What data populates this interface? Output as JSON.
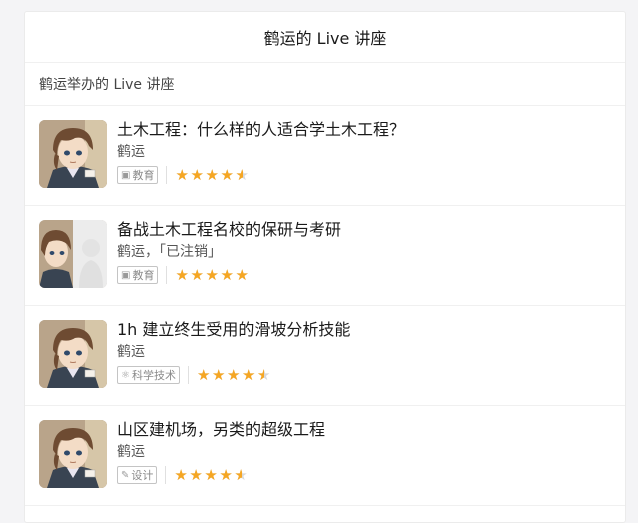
{
  "header": {
    "title": "鹤运的 Live 讲座"
  },
  "subheader": {
    "label": "鹤运举办的 Live 讲座"
  },
  "colors": {
    "star": "#f5a623",
    "star_empty": "#d9d9d9"
  },
  "lives": [
    {
      "title": "土木工程：什么样的人适合学土木工程？",
      "speaker": "鹤运",
      "tag": "教育",
      "tag_icon": "education-icon",
      "rating": 4.5,
      "cover": "anime-avatar"
    },
    {
      "title": "备战土木工程名校的保研与考研",
      "speaker": "鹤运，「已注销」",
      "tag": "教育",
      "tag_icon": "education-icon",
      "rating": 5,
      "cover": "split-avatar"
    },
    {
      "title": "1h 建立终生受用的滑坡分析技能",
      "speaker": "鹤运",
      "tag": "科学技术",
      "tag_icon": "science-icon",
      "rating": 4.5,
      "cover": "anime-avatar"
    },
    {
      "title": "山区建机场，另类的超级工程",
      "speaker": "鹤运",
      "tag": "设计",
      "tag_icon": "design-icon",
      "rating": 4.5,
      "cover": "anime-avatar"
    }
  ]
}
